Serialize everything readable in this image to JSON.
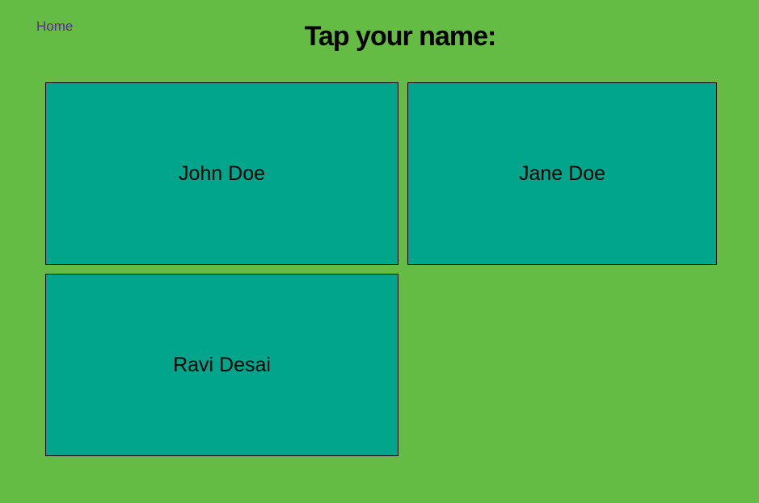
{
  "nav": {
    "home_label": "Home"
  },
  "header": {
    "title": "Tap your name:"
  },
  "people": [
    {
      "name": "John Doe"
    },
    {
      "name": "Jane Doe"
    },
    {
      "name": "Ravi Desai"
    }
  ],
  "colors": {
    "background": "#64bc45",
    "tile": "#00a58c",
    "link": "#5b2a9c"
  }
}
